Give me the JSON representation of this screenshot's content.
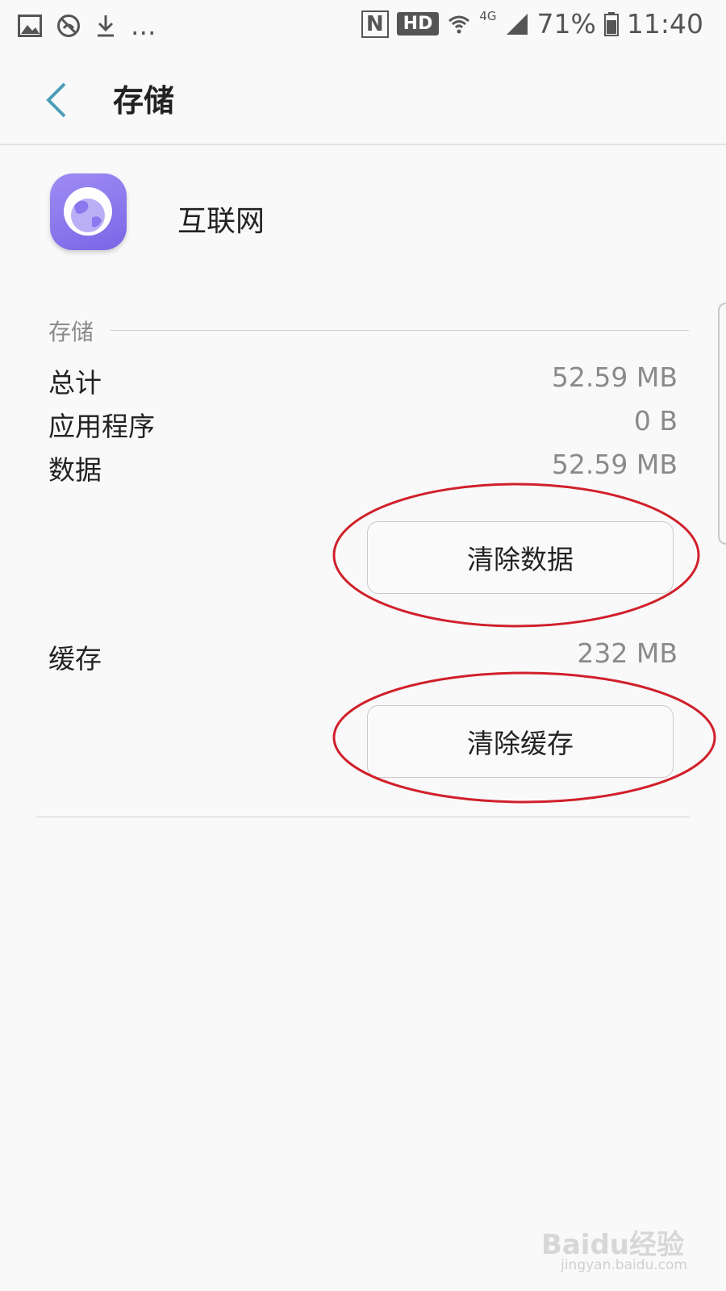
{
  "status_bar": {
    "left_icons": [
      "image-icon",
      "blocked-call-icon",
      "download-icon"
    ],
    "more": "...",
    "nfc": "N",
    "hd": "HD",
    "network": "4G",
    "battery": "71%",
    "time": "11:40"
  },
  "header": {
    "title": "存储"
  },
  "app": {
    "name": "互联网"
  },
  "storage": {
    "section_label": "存储",
    "rows": [
      {
        "label": "总计",
        "value": "52.59 MB"
      },
      {
        "label": "应用程序",
        "value": "0 B"
      },
      {
        "label": "数据",
        "value": "52.59 MB"
      }
    ],
    "clear_data_label": "清除数据",
    "cache_label": "缓存",
    "cache_value": "232 MB",
    "clear_cache_label": "清除缓存"
  },
  "watermark": {
    "text": "Baidu经验",
    "sub": "jingyan.baidu.com"
  },
  "colors": {
    "accent": "#4a9fb8",
    "annotation": "#d0202a",
    "icon_purple": "#8b78ee"
  }
}
